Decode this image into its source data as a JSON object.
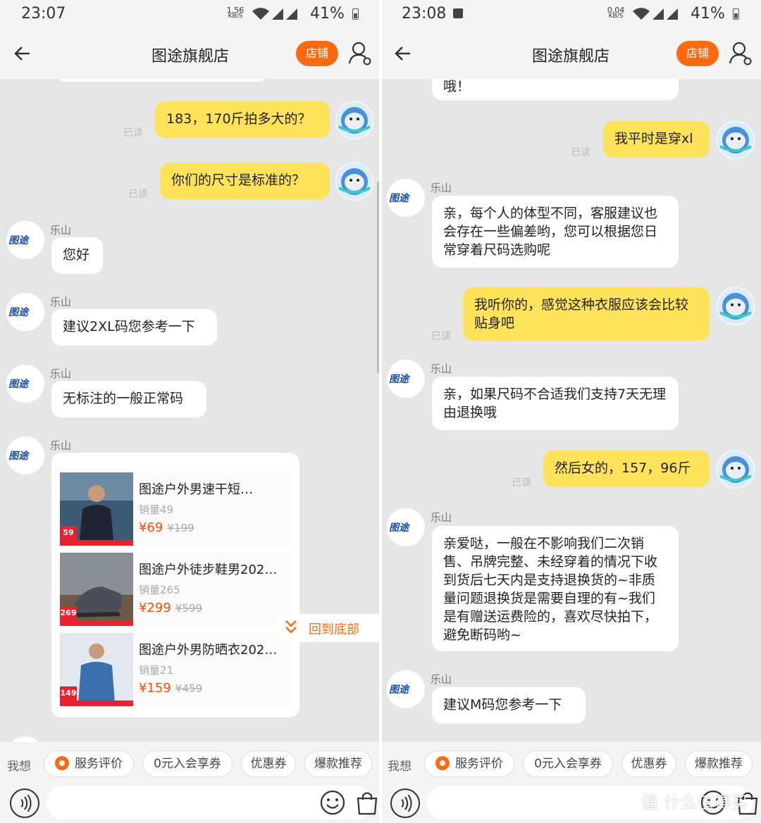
{
  "left": {
    "status": {
      "time": "23:07",
      "speed": "1.56",
      "speed_unit": "KB/S",
      "battery": "41%"
    },
    "header": {
      "title": "图途旗舰店",
      "store_button": "店铺"
    },
    "messages": {
      "out1": "183，170斤拍多大的？",
      "out2": "你们的尺寸是标准的？",
      "read": "已读",
      "sender": "乐山",
      "in1": "您好",
      "in2": "建议2XL码您参考一下",
      "in3": "无标注的一般正常码"
    },
    "products": [
      {
        "name": "图途户外男速干短…",
        "sales": "销量49",
        "price": "¥69",
        "original": "¥199",
        "tag": "59"
      },
      {
        "name": "图途户外徒步鞋男202…",
        "sales": "销量265",
        "price": "¥299",
        "original": "¥599",
        "tag": "269"
      },
      {
        "name": "图途户外男防晒衣202…",
        "sales": "销量21",
        "price": "¥159",
        "original": "¥459",
        "tag": "149"
      }
    ],
    "scroll_to_bottom": "回到底部"
  },
  "right": {
    "status": {
      "time": "23:08",
      "speed": "0.04",
      "speed_unit": "KB/S",
      "battery": "41%"
    },
    "header": {
      "title": "图途旗舰店",
      "store_button": "店铺"
    },
    "messages": {
      "top_fragment": "哦！",
      "out1": "我平时是穿xl",
      "in1": "亲，每个人的体型不同，客服建议也会存在一些偏差哟，您可以根据您日常穿着尺码选购呢",
      "out2": "我听你的，感觉这种衣服应该会比较贴身吧",
      "in2": "亲，如果尺码不合适我们支持7天无理由退换哦",
      "out3": "然后女的，157，96斤",
      "in3": "亲爱哒，一般在不影响我们二次销售、吊牌完整、未经穿着的情况下收到货后七天内是支持退换货的~非质量问题退换货是需要自理的有~我们是有赠送运费险的，喜欢尽快拍下，避免断码哟~",
      "in4": "建议M码您参考一下",
      "read": "已读",
      "sender": "乐山"
    }
  },
  "quickbar": {
    "want": "我想",
    "chips": [
      "服务评价",
      "0元入会享券",
      "优惠券",
      "爆款推荐"
    ]
  },
  "shop_logo": "图途",
  "watermark": "值 什么值得买",
  "colors": {
    "accent": "#ff6a10",
    "out_bubble": "#fde25a",
    "price": "#ff4a00"
  }
}
